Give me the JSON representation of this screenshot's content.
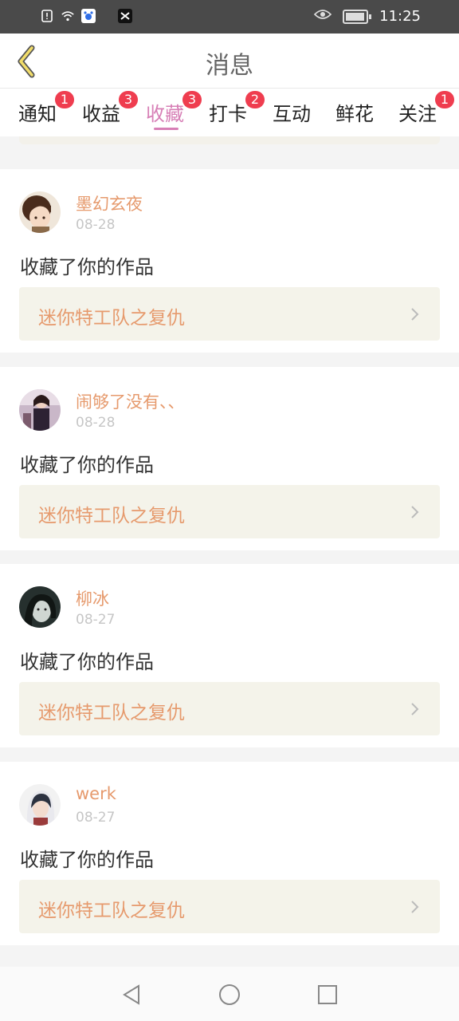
{
  "status_bar": {
    "time": "11:25",
    "battery_level": 0.95,
    "icons": [
      "alert-icon",
      "wifi-icon",
      "baidu-app-icon",
      "capcut-app-icon",
      "eye-icon",
      "battery-icon"
    ]
  },
  "header": {
    "title": "消息"
  },
  "tabs": [
    {
      "label": "通知",
      "badge": "1"
    },
    {
      "label": "收益",
      "badge": "3"
    },
    {
      "label": "收藏",
      "badge": "3",
      "active": true
    },
    {
      "label": "打卡",
      "badge": "2"
    },
    {
      "label": "互动",
      "badge": ""
    },
    {
      "label": "鲜花",
      "badge": ""
    },
    {
      "label": "关注",
      "badge": "1"
    }
  ],
  "messages": [
    {
      "user": "墨幻玄夜",
      "date": "08-28",
      "action": "收藏了你的作品",
      "work": "迷你特工队之复仇"
    },
    {
      "user": "闹够了没有、、",
      "date": "08-28",
      "action": "收藏了你的作品",
      "work": "迷你特工队之复仇"
    },
    {
      "user": "柳冰",
      "date": "08-27",
      "action": "收藏了你的作品",
      "work": "迷你特工队之复仇"
    },
    {
      "user": "werk",
      "date": "08-27",
      "action": "收藏了你的作品",
      "work": "迷你特工队之复仇"
    }
  ],
  "colors": {
    "accent": "#d77fb6",
    "badge": "#ef3d4f",
    "username": "#e69a6d",
    "status_bar": "#4a4a4a"
  },
  "nav_icons": [
    "back-triangle-icon",
    "home-circle-icon",
    "recents-square-icon"
  ]
}
